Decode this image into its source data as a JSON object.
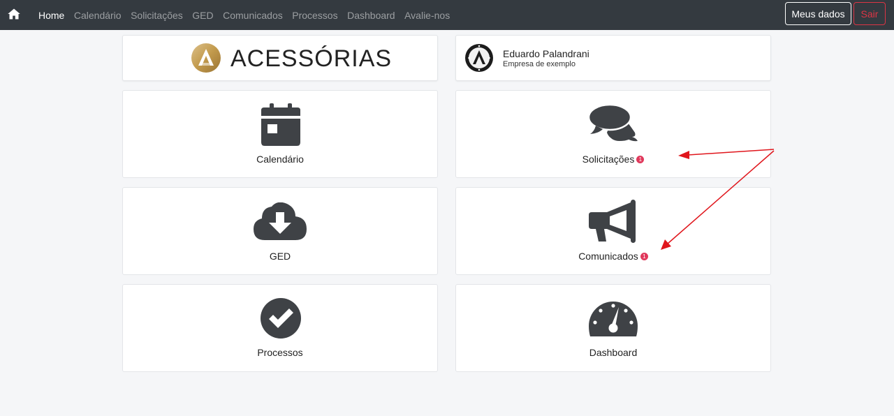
{
  "navbar": {
    "links": [
      {
        "label": "Home",
        "active": true
      },
      {
        "label": "Calendário",
        "active": false
      },
      {
        "label": "Solicitações",
        "active": false
      },
      {
        "label": "GED",
        "active": false
      },
      {
        "label": "Comunicados",
        "active": false
      },
      {
        "label": "Processos",
        "active": false
      },
      {
        "label": "Dashboard",
        "active": false
      },
      {
        "label": "Avalie-nos",
        "active": false
      }
    ],
    "meus_dados_label": "Meus dados",
    "sair_label": "Sair"
  },
  "brand": {
    "name": "ACESSÓRIAS"
  },
  "user": {
    "name": "Eduardo Palandrani",
    "company": "Empresa de exemplo"
  },
  "tiles": {
    "calendario": {
      "label": "Calendário",
      "icon": "calendar-icon"
    },
    "solicitacoes": {
      "label": "Solicitações",
      "icon": "comments-icon",
      "badge": "1"
    },
    "ged": {
      "label": "GED",
      "icon": "cloud-download-icon"
    },
    "comunicados": {
      "label": "Comunicados",
      "icon": "megaphone-icon",
      "badge": "1"
    },
    "processos": {
      "label": "Processos",
      "icon": "check-circle-icon"
    },
    "dashboard": {
      "label": "Dashboard",
      "icon": "gauge-icon"
    }
  },
  "colors": {
    "navbar": "#343a40",
    "icon": "#3f4246",
    "badge": "#e0385b",
    "arrow": "#e0161c",
    "sair": "#dc3545",
    "brand_gold": "#c9a45a"
  }
}
